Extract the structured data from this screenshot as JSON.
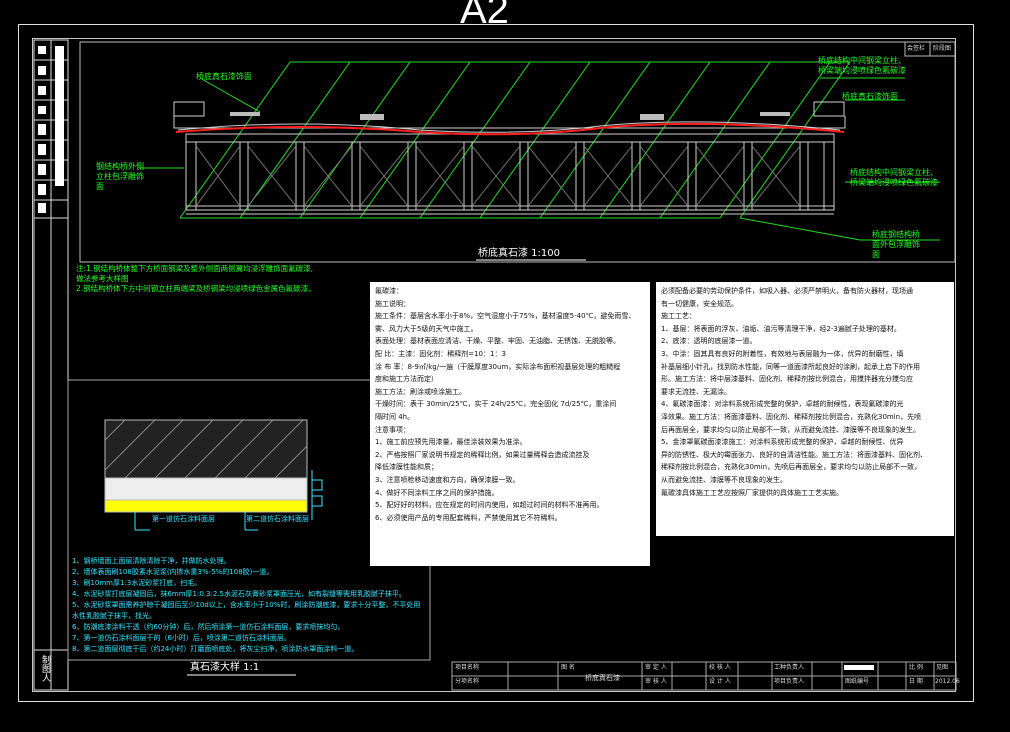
{
  "sheet": {
    "size_label": "A2"
  },
  "drawing": {
    "main_title": "桥底真石漆  1:100",
    "detail_title": "真石漆大样  1:1",
    "callouts": {
      "top_left": "桥底真石漆饰面",
      "top_mid": "桥底真石漆饰面",
      "top_right": [
        "桥底结构中间钢梁立柱、",
        "桥梁端均浸喷绿色氟碳漆"
      ],
      "mid_right": [
        "桥底结构中间钢梁立柱、",
        "桥梁端均浸喷绿色氟碳漆"
      ],
      "left": [
        "钢结构桥外侧",
        "立柱包浮雕饰",
        "面"
      ],
      "bottom_right": [
        "桥底钢结构桥",
        "面外包浮雕饰",
        "面"
      ]
    },
    "notes": [
      "注:1.钢结构桥体整下方桥面钢梁及整外侧面两侧翼均浸浮雕饰面氟碳漆,",
      "      做法参考大样图",
      "    2.钢结构桥体下方中间钢立柱两端梁及桥钢梁均浸喷绿色金属色氟碳漆。"
    ],
    "detail_labels": [
      "第一道仿石涂料面层",
      "第二道仿石涂料面层"
    ],
    "detail_steps": [
      "1、钢桥墙面上面层清除清除干净，并做防水处理。",
      "2、墙体表面刷108胶素水泥浆(内掺水重3%-5%的108胶)一道。",
      "3、刷10mm厚1:3水泥砂浆打底，扫毛。",
      "4、水泥砂浆打底层凝固后，抹6mm厚1:0.3:2.5水泥石灰膏砂浆罩面压光，如有裂缝等需用乳胶腻子抹平。",
      "5、水泥砂浆罩面需养护晾干凝固后至少10d以上，含水率小于10%时，刷涂防潮底漆，要求十分平整，不平处用",
      "    水性乳胶腻子抹平，找光。",
      "6、防潮底漆涂料干透（约60分钟）后，然后喷涂第一道仿石涂料面层，要求喷抹均匀。",
      "7、第一道仿石涂料面层干的（6小时）后，喷涂第二道仿石涂料面层。",
      "8、第二道面层彻底干后（约24小时）打磨面喷底处，将灰尘扫净，喷涂防水罩面涂料一道。"
    ],
    "spec_left": [
      "氟碳漆：",
      "施工说明：",
      "施工条件：基层含水率小于8%，空气湿度小于75%，基材温度5-40℃，避免雨雪、",
      "          雾、风力大于5级的天气中施工。",
      "表面处理：基材表面应清洁、干燥、平整、牢固、无油脂、无锈蚀、无脱胶等。",
      "配    比：主漆：固化剂：稀释剂=10：1：3",
      "涂 布 率：8-9㎡/kg/一遍（干膜厚度30um，实际涂布面积视基层处理的粗糙程",
      "          度和施工方法而定）",
      "施工方法：刷涂或喷涂施工。",
      "干燥时间：表干 30min/25℃，实干 24h/25℃，完全固化 7d/25℃，重涂间",
      "          隔时间 4h。",
      "注意事项：",
      "      1、施工前应预先用漆量，最佳涂装效果为准涂。",
      "      2、严格按照厂家说明书规定的稀释比例，如果过量稀释会造成流挂及",
      "         降低漆膜性能和质；",
      "      3、注意喷枪移动速度和方向，确保漆膜一致。",
      "      4、做好不同涂料工序之间的保护措施。",
      "      5、配好好的材料，应在规定的时间内使用，如超过时间的材料不准再用。",
      "      6、必须使用产品的专用配套稀料，严禁使用其它不符稀料。"
    ],
    "spec_right": [
      "必须配备必要的劳动保护条件，如吸入器、必须严禁明火，备有防火器材，现场通",
      "有一切健康，安全规范。",
      "      施工工艺：",
      "      1、基层：将表面的浮灰、油垢、油污等清理干净，经2-3遍腻子处理的基材。",
      "      2、底漆：透明的底层漆一道。",
      "      3、中涂：固其具有良好的附着性，有效地与表层融为一体，优异的耐磨性，填",
      "补基层细小针孔，找到防水性能，同等一道面漆所起良好的涂刷，起承上启下的作用",
      "形。施工方法：将中层漆基料、固化剂、稀释剂按比例混合，用搅拌器充分搅匀应",
      "要求无流挂、无漏涂。",
      "      4、氟碳漆面漆：对涂料系统形成完整的保护，卓越的耐候性，表现氟碳漆的光",
      "泽效果。施工方法：将面漆基料、固化剂、稀释剂按比例混合，充熟化30min，先喷",
      "后再面层全，要求均匀以防止局部不一致，从而避免流挂、漆膜等不良现象的发生。",
      "      5、金漆罩氟碳面漆漆施工：对涂料系统形成完整的保护，卓越的耐候性、优异",
      "异的防锈性、极大的霉面张力、良好的自清洁性能。施工方法：将面漆基料、固化剂、",
      "稀释剂按比例混合，充熟化30min，先喷后再面层全，要求均匀以防止局部不一致，",
      "从而避免流挂、漆膜等不良现象的发生。",
      "      氟碳漆具体施工工艺应按照厂家提供的具体施工工艺实施。"
    ],
    "title_block": {
      "project_name_label": "项目名称",
      "branch_label": "分项名称",
      "drawing_name_label": "图    名",
      "drawing_name": "桥底真石漆",
      "reviewer_label": "审 定 人",
      "checker_label": "审 核 人",
      "proofer_label": "校 核 人",
      "designer_label": "设 计 人",
      "lead_label": "工种负责人",
      "project_lead_label": "项目负责人",
      "drawing_no_label": "图纸编号",
      "scale_label": "比  例",
      "scale_value": "见图",
      "date_label": "日  期",
      "date_value": "2012.06"
    },
    "stamp_top_right": [
      "会签栏",
      "阶段图"
    ],
    "side_label": "制图人"
  }
}
